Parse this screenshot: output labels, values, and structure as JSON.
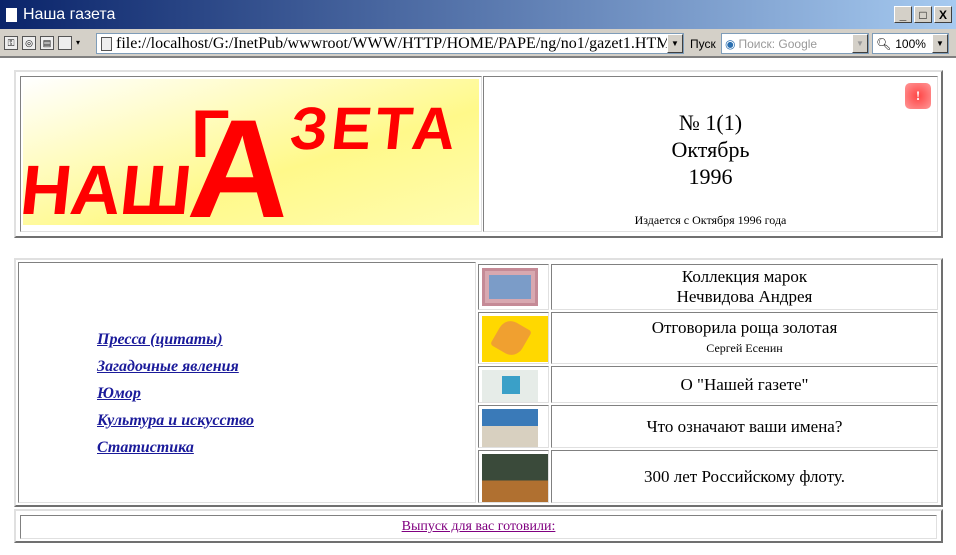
{
  "window": {
    "title": "Наша газета"
  },
  "toolbar": {
    "address": "file://localhost/G:/InetPub/wwwroot/WWW/HTTP/HOME/PAPE/ng/no1/gazet1.HTM",
    "go_label": "Пуск",
    "search_placeholder": "Поиск: Google",
    "zoom": "100%"
  },
  "header": {
    "logo_text": "НАШ ГАЗЕТА",
    "issue": "№ 1(1)",
    "month": "Октябрь",
    "year": "1996",
    "since": "Издается с Октября 1996 года"
  },
  "nav": [
    "Пресса (цитаты)",
    "Загадочные явления",
    "Юмор",
    "Культура и искусство",
    "Статистика"
  ],
  "articles": [
    {
      "title": "Коллекция марок",
      "subtitle": "Нечвидова Андрея",
      "thumb": "stamp"
    },
    {
      "title": "Отговорила роща золотая",
      "author": "Сергей Есенин",
      "thumb": "leaf"
    },
    {
      "title": "О \"Нашей газете\"",
      "thumb": "abstract"
    },
    {
      "title": "Что означают ваши имена?",
      "thumb": "car"
    },
    {
      "title": "300 лет Российскому флоту.",
      "thumb": "boat"
    }
  ],
  "footer": {
    "link": "Выпуск для вас готовили:"
  },
  "colors": {
    "logo_red": "#ff0000",
    "link": "#1a1a9a",
    "visited": "#800080"
  }
}
